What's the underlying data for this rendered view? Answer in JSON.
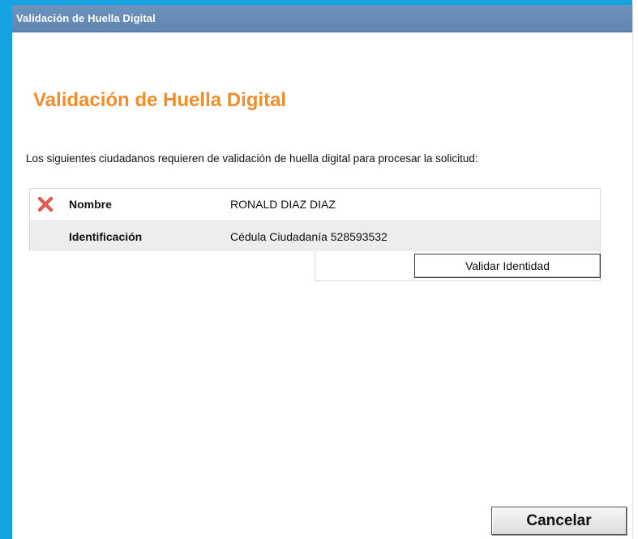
{
  "window": {
    "title": "Validación de Huella Digital"
  },
  "main": {
    "heading": "Validación de Huella Digital",
    "intro": "Los siguientes ciudadanos requieren de validación de huella digital para procesar la solicitud:",
    "citizen": {
      "status_icon": "x-icon",
      "status_color": "#d94b3d",
      "rows": [
        {
          "label": "Nombre",
          "value": "RONALD DIAZ DIAZ"
        },
        {
          "label": "Identificación",
          "value": "Cédula Ciudadanía 528593532"
        }
      ]
    },
    "validate_button": "Validar Identidad"
  },
  "footer": {
    "cancel_button": "Cancelar"
  },
  "colors": {
    "frame": "#16a3e4",
    "titlebar": "#6589b5",
    "heading": "#f28d2b",
    "alt_row": "#ededed"
  }
}
